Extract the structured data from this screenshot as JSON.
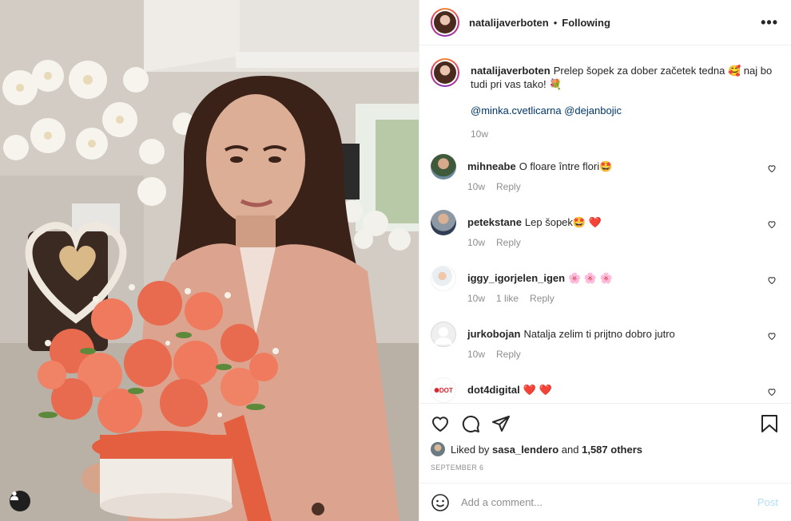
{
  "post": {
    "author": "natalijaverboten",
    "following_label": "Following",
    "more_label": "•••",
    "caption_text": "Prelep šopek za dober začetek tedna 🥰 naj bo tudi pri vas tako! 💐",
    "caption_mentions": "@minka.cvetlicarna @dejanbojic",
    "caption_time": "10w"
  },
  "comments": [
    {
      "user": "mihneabe",
      "text": "O floare între flori🤩",
      "time": "10w",
      "likes": "",
      "reply": "Reply"
    },
    {
      "user": "petekstane",
      "text": "Lep šopek🤩 ❤️",
      "time": "10w",
      "likes": "",
      "reply": "Reply"
    },
    {
      "user": "iggy_igorjelen_igen",
      "text": "🌸 🌸 🌸",
      "time": "10w",
      "likes": "1 like",
      "reply": "Reply"
    },
    {
      "user": "jurkobojan",
      "text": "Natalja zelim ti prijtno dobro jutro",
      "time": "10w",
      "likes": "",
      "reply": "Reply"
    },
    {
      "user": "dot4digital",
      "text": "❤️ ❤️",
      "time": "",
      "likes": "",
      "reply": ""
    }
  ],
  "likes": {
    "liked_by_prefix": "Liked by",
    "liked_by_user": "sasa_lendero",
    "and_text": "and",
    "others": "1,587 others"
  },
  "date": "September 6",
  "add_comment": {
    "placeholder": "Add a comment...",
    "post_label": "Post"
  },
  "icons": {
    "like": "heart-icon",
    "comment": "comment-icon",
    "share": "send-icon",
    "save": "bookmark-icon",
    "emoji": "emoji-icon",
    "tag": "user-tag-icon"
  },
  "colors": {
    "link": "#00376b",
    "muted": "#8e8e8e",
    "post_disabled": "#b2dffc",
    "heart_red": "#ed4956"
  }
}
